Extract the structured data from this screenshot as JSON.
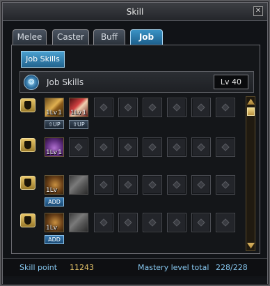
{
  "window": {
    "title": "Skill",
    "close_label": "✕"
  },
  "tabs": [
    {
      "label": "Melee",
      "active": false
    },
    {
      "label": "Caster",
      "active": false
    },
    {
      "label": "Buff",
      "active": false
    },
    {
      "label": "Job",
      "active": true
    }
  ],
  "subtab": {
    "label": "Job Skills"
  },
  "header": {
    "title": "Job Skills",
    "level": "Lv 40",
    "icon": "job-emblem-icon"
  },
  "rows": [
    {
      "skills": [
        {
          "icon": "sword-skill-icon",
          "level": "1Lv",
          "count": "1",
          "button": "UP"
        },
        {
          "icon": "scroll-skill-icon",
          "level": "1Lv",
          "count": "1",
          "button": "UP"
        }
      ]
    },
    {
      "skills": [
        {
          "icon": "bag-skill-icon",
          "level": "1Lv",
          "count": "1",
          "button": ""
        }
      ]
    },
    {
      "skills": [
        {
          "icon": "leaf-skill-icon",
          "level": "1Lv",
          "count": "",
          "button": "ADD"
        },
        {
          "icon": "book-skill-icon",
          "level": "",
          "count": "",
          "button": ""
        }
      ]
    },
    {
      "skills": [
        {
          "icon": "leaf-skill-icon",
          "level": "1Lv",
          "count": "",
          "button": "ADD"
        },
        {
          "icon": "book-skill-icon",
          "level": "",
          "count": "",
          "button": ""
        }
      ]
    }
  ],
  "footer": {
    "skill_point_label": "Skill point",
    "skill_point_value": "11243",
    "mastery_label": "Mastery level total",
    "mastery_value": "228/228"
  },
  "colors": {
    "accent_blue": "#2a7ab0",
    "gold": "#e8c66a",
    "label_blue": "#86c6ee"
  }
}
